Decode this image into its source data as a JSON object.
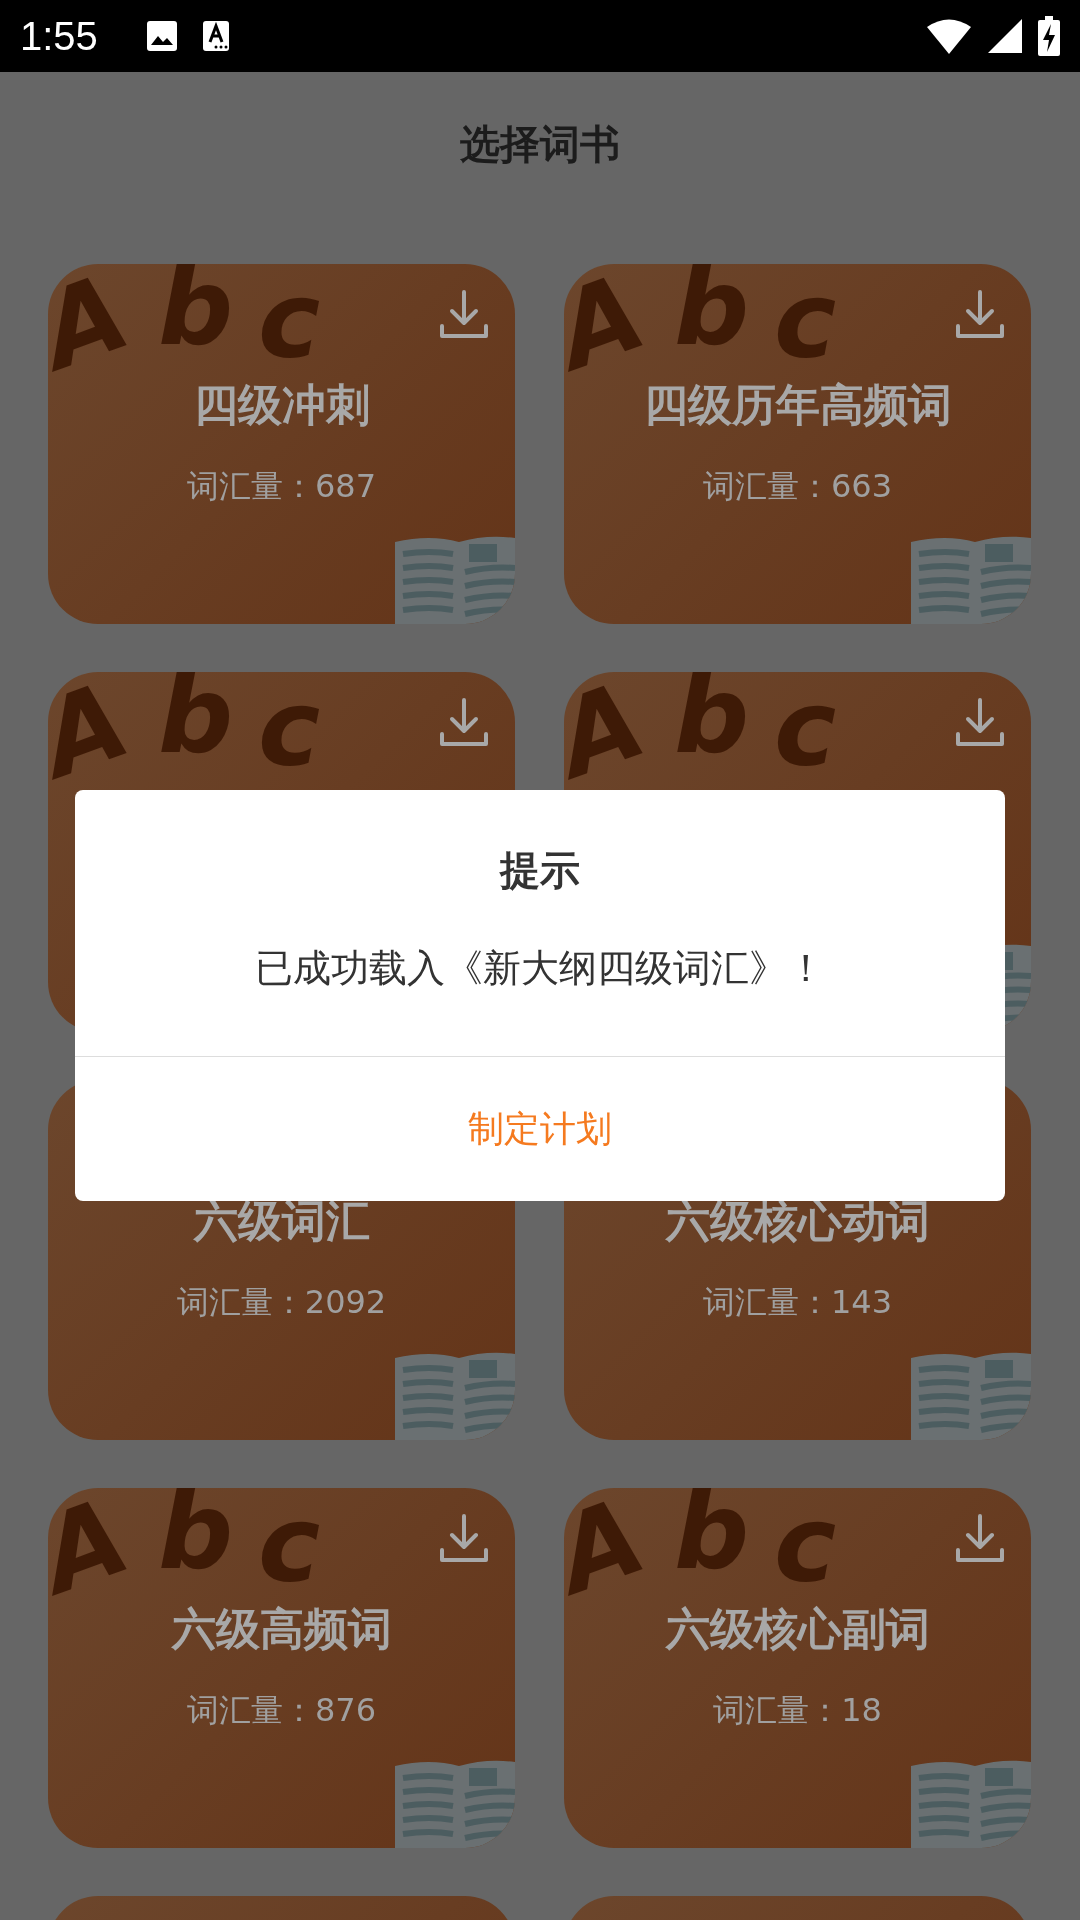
{
  "status_bar": {
    "time": "1:55"
  },
  "header": {
    "title": "选择词书"
  },
  "books": [
    {
      "letters": [
        "A",
        "b",
        "c"
      ],
      "title": "四级冲刺",
      "count": "词汇量：687",
      "download": true,
      "book": true
    },
    {
      "letters": [
        "A",
        "b",
        "c"
      ],
      "title": "四级历年高频词",
      "count": "词汇量：663",
      "download": true,
      "book": true
    },
    {
      "letters": [
        "A",
        "b",
        "c"
      ],
      "download": true,
      "book": false
    },
    {
      "letters": [
        "A",
        "b",
        "c"
      ],
      "download": true,
      "book": true
    },
    {
      "title": "六级词汇",
      "count": "词汇量：2092",
      "download": false,
      "book": true
    },
    {
      "title": "六级核心动词",
      "count": "词汇量：143",
      "download": false,
      "book": true
    },
    {
      "letters": [
        "A",
        "b",
        "c"
      ],
      "title": "六级高频词",
      "count": "词汇量：876",
      "download": true,
      "book": true
    },
    {
      "letters": [
        "A",
        "b",
        "c"
      ],
      "title": "六级核心副词",
      "count": "词汇量：18",
      "download": true,
      "book": true
    },
    {
      "download": false,
      "book": false
    },
    {
      "download": false,
      "book": false
    }
  ],
  "dialog": {
    "title": "提示",
    "message": "已成功载入《新大纲四级词汇》！",
    "button": "制定计划"
  }
}
